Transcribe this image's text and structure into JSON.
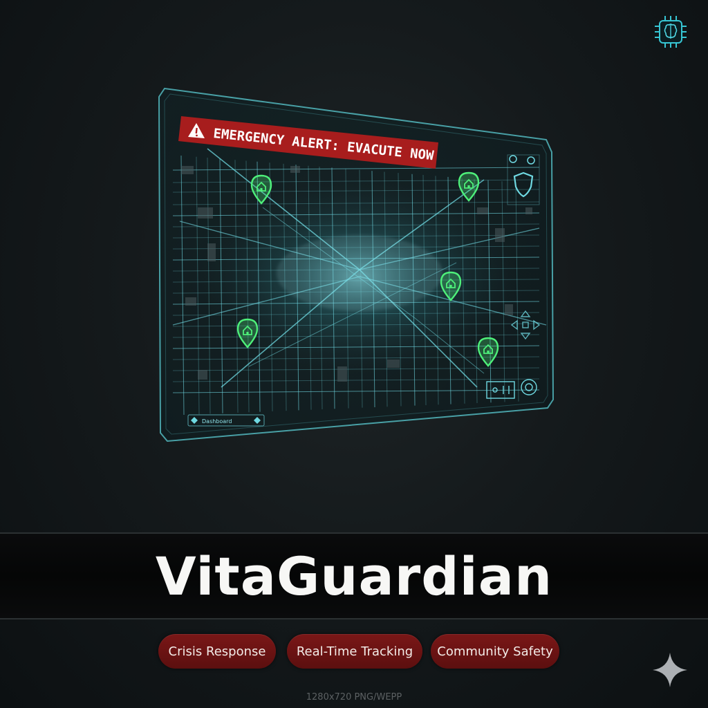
{
  "alert": {
    "text": "EMERGENCY ALERT: EVACUTE NOW",
    "icon": "warning-icon"
  },
  "map": {
    "pins": [
      "home-pin-icon",
      "home-pin-icon",
      "home-pin-icon",
      "home-pin-icon",
      "home-pin-icon"
    ],
    "bottom_bar_label": "Dashboard",
    "accent": "#5fd8e0",
    "pin_color": "#4ef07a"
  },
  "brand": {
    "title": "VitaGuardian",
    "logo_icon": "brain-chip-icon"
  },
  "tags": [
    "Crisis Response",
    "Real-Time Tracking",
    "Community Safety"
  ],
  "footnote": "1280x720 PNG/WEPP",
  "colors": {
    "alert_red": "#b01e1e",
    "tag_red": "#6b1414",
    "background": "#151a1c"
  }
}
